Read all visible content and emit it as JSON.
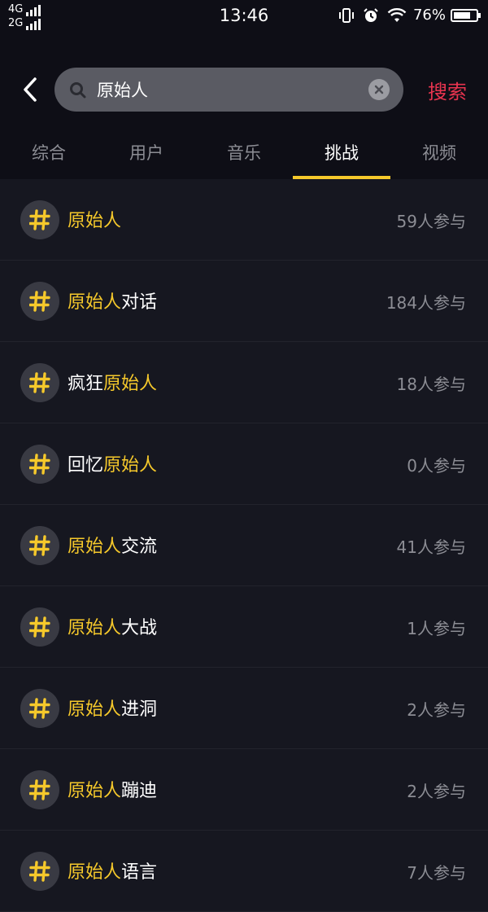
{
  "status_bar": {
    "network_top": "4G",
    "network_bottom": "2G",
    "time": "13:46",
    "battery": "76%",
    "battery_level": 0.76,
    "icons": [
      "vibrate-icon",
      "alarm-icon",
      "wifi-icon",
      "battery-icon"
    ]
  },
  "search": {
    "query": "原始人",
    "submit_label": "搜索"
  },
  "tabs": [
    {
      "label": "综合",
      "active": false
    },
    {
      "label": "用户",
      "active": false
    },
    {
      "label": "音乐",
      "active": false
    },
    {
      "label": "挑战",
      "active": true
    },
    {
      "label": "视频",
      "active": false
    }
  ],
  "colors": {
    "accent_yellow": "#f6c92b",
    "search_red": "#e8344f",
    "background": "#161720"
  },
  "results": [
    {
      "prefix": "",
      "highlight": "原始人",
      "suffix": "",
      "count": "59人参与"
    },
    {
      "prefix": "",
      "highlight": "原始人",
      "suffix": "对话",
      "count": "184人参与"
    },
    {
      "prefix": "疯狂",
      "highlight": "原始人",
      "suffix": "",
      "count": "18人参与"
    },
    {
      "prefix": "回忆",
      "highlight": "原始人",
      "suffix": "",
      "count": "0人参与"
    },
    {
      "prefix": "",
      "highlight": "原始人",
      "suffix": "交流",
      "count": "41人参与"
    },
    {
      "prefix": "",
      "highlight": "原始人",
      "suffix": "大战",
      "count": "1人参与"
    },
    {
      "prefix": "",
      "highlight": "原始人",
      "suffix": "进洞",
      "count": "2人参与"
    },
    {
      "prefix": "",
      "highlight": "原始人",
      "suffix": "蹦迪",
      "count": "2人参与"
    },
    {
      "prefix": "",
      "highlight": "原始人",
      "suffix": "语言",
      "count": "7人参与"
    }
  ]
}
